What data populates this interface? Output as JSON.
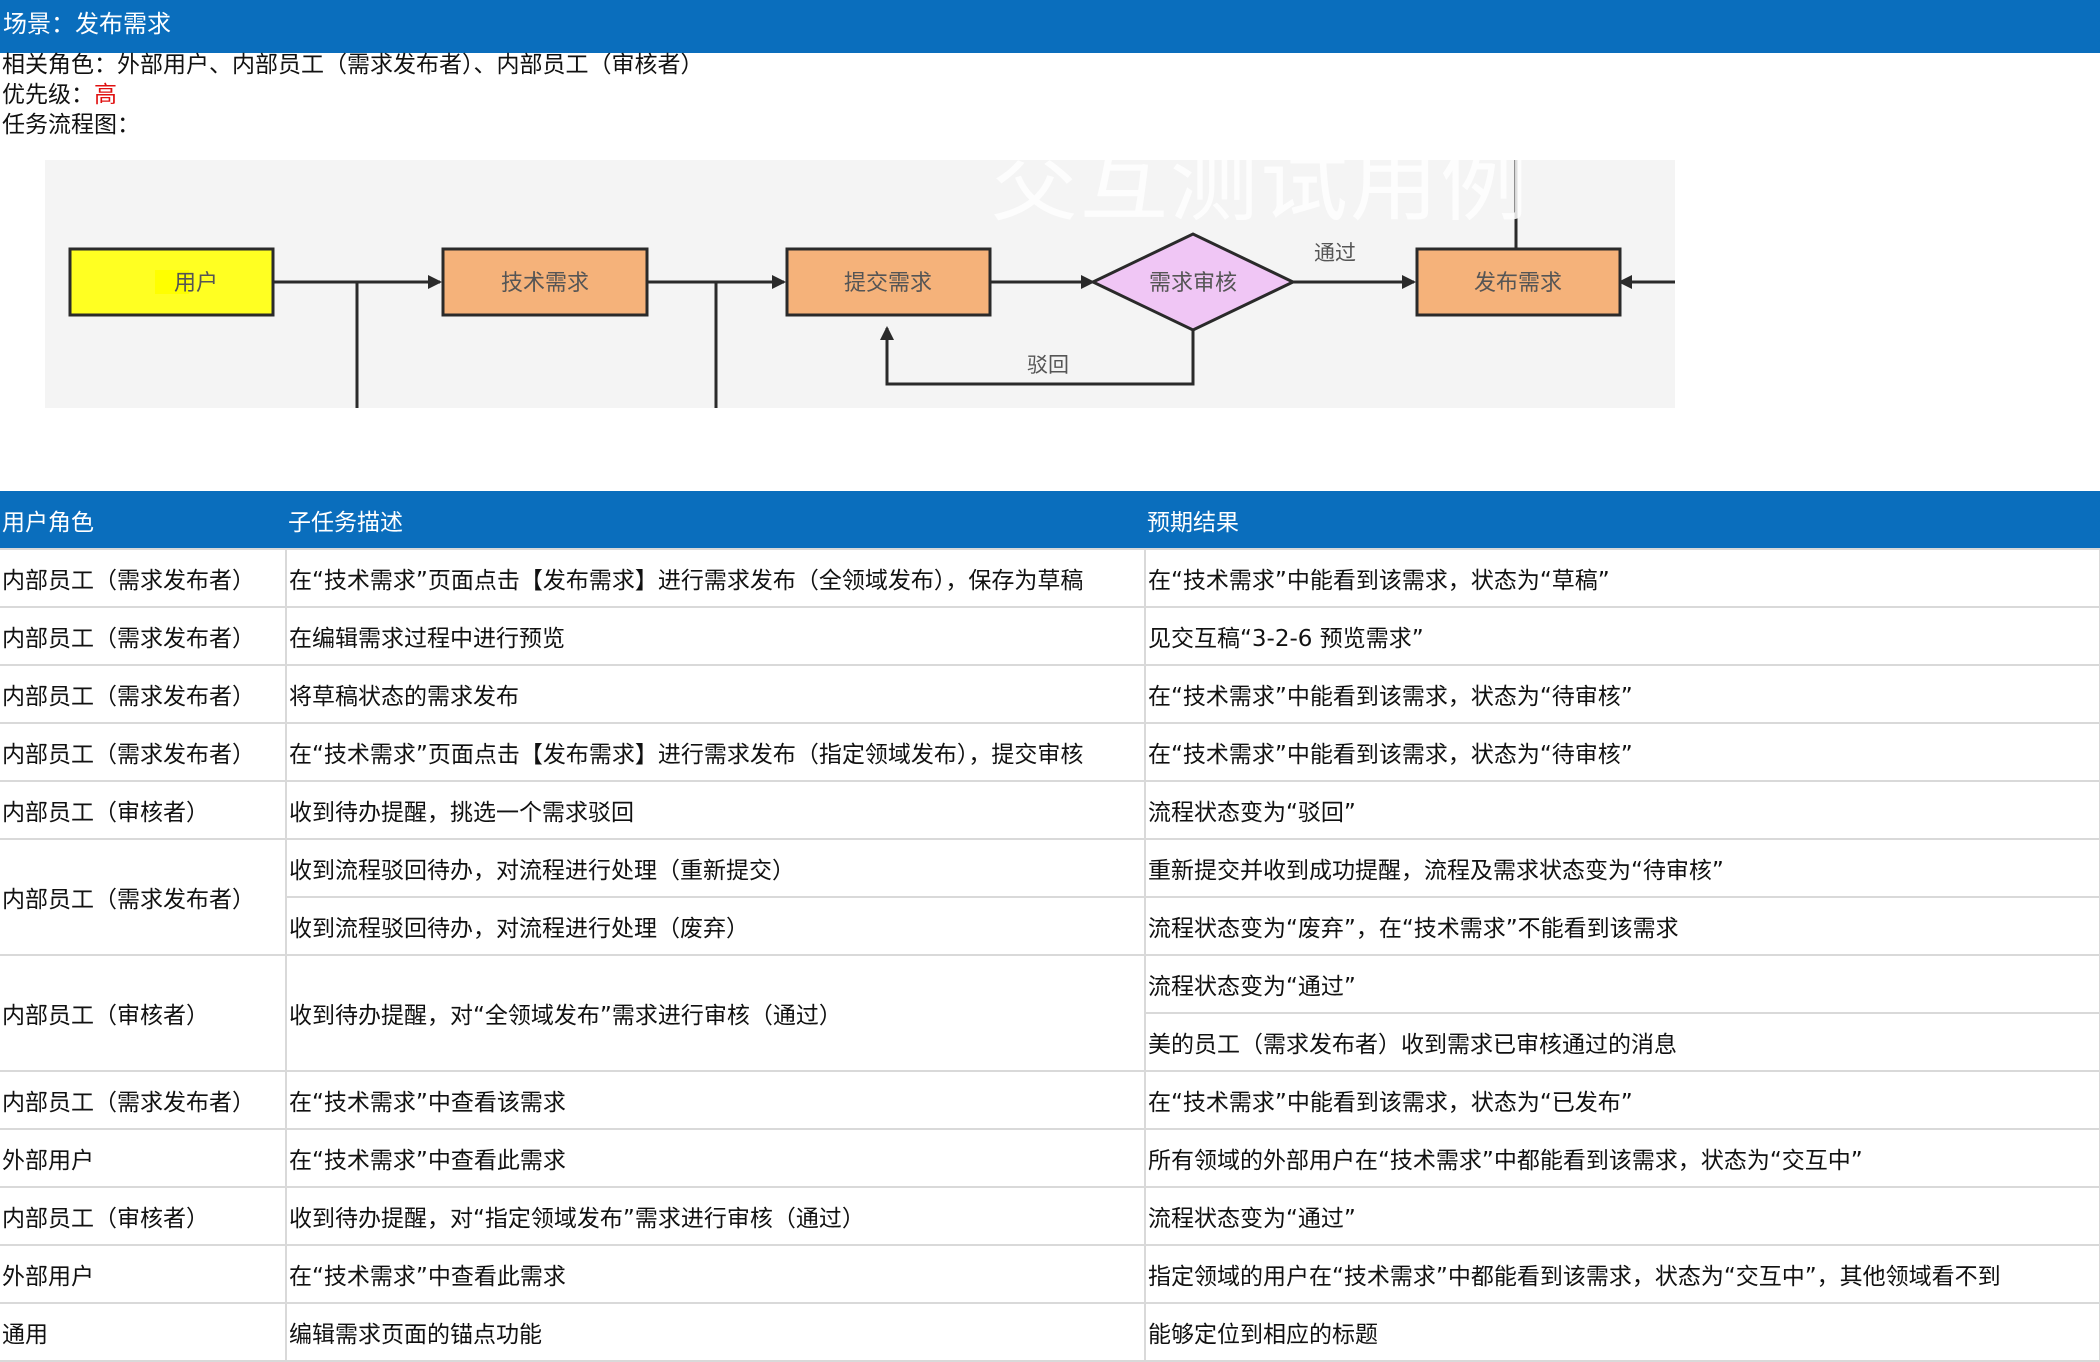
{
  "scene": "场景：发布需求",
  "roles_line": "相关角色：外部用户、内部员工（需求发布者）、内部员工（审核者）",
  "priority": {
    "label": "优先级：",
    "value": "高",
    "value_color": "#e01010"
  },
  "flow_label": "任务流程图：",
  "watermark": "交互测试用例",
  "diagram": {
    "user": "用户",
    "tech_demand": "技术需求",
    "submit_demand": "提交需求",
    "review": "需求审核",
    "publish": "发布需求",
    "pass_label": "通过",
    "reject_label": "驳回"
  },
  "table": {
    "headers": [
      "用户角色",
      "子任务描述",
      "预期结果"
    ],
    "rows": [
      {
        "role": "内部员工（需求发布者）",
        "task": "在“技术需求”页面点击【发布需求】进行需求发布（全领域发布），保存为草稿",
        "result": "在“技术需求”中能看到该需求，状态为“草稿”"
      },
      {
        "role": "内部员工（需求发布者）",
        "task": "在编辑需求过程中进行预览",
        "result": "见交互稿“3-2-6 预览需求”"
      },
      {
        "role": "内部员工（需求发布者）",
        "task": "将草稿状态的需求发布",
        "result": "在“技术需求”中能看到该需求，状态为“待审核”"
      },
      {
        "role": "内部员工（需求发布者）",
        "task": "在“技术需求”页面点击【发布需求】进行需求发布（指定领域发布），提交审核",
        "result": "在“技术需求”中能看到该需求，状态为“待审核”"
      },
      {
        "role": "内部员工（审核者）",
        "task": "收到待办提醒，挑选一个需求驳回",
        "result": "流程状态变为“驳回”"
      },
      {
        "role": "内部员工（需求发布者）",
        "task": "收到流程驳回待办，对流程进行处理（重新提交）",
        "result": "重新提交并收到成功提醒，流程及需求状态变为“待审核”"
      },
      {
        "task": "收到流程驳回待办，对流程进行处理（废弃）",
        "result": "流程状态变为“废弃”，在“技术需求”不能看到该需求"
      },
      {
        "role": "内部员工（审核者）",
        "task": "收到待办提醒，对“全领域发布”需求进行审核（通过）",
        "result": "流程状态变为“通过”"
      },
      {
        "result": "美的员工（需求发布者）收到需求已审核通过的消息"
      },
      {
        "role": "内部员工（需求发布者）",
        "task": "在“技术需求”中查看该需求",
        "result": "在“技术需求”中能看到该需求，状态为“已发布”"
      },
      {
        "role": "外部用户",
        "task": "在“技术需求”中查看此需求",
        "result": "所有领域的外部用户在“技术需求”中都能看到该需求，状态为“交互中”"
      },
      {
        "role": "内部员工（审核者）",
        "task": "收到待办提醒，对“指定领域发布”需求进行审核（通过）",
        "result": "流程状态变为“通过”"
      },
      {
        "role": "外部用户",
        "task": "在“技术需求”中查看此需求",
        "result": "指定领域的用户在“技术需求”中都能看到该需求，状态为“交互中”，其他领域看不到"
      },
      {
        "role": "通用",
        "task": "编辑需求页面的锚点功能",
        "result": "能够定位到相应的标题"
      }
    ]
  }
}
